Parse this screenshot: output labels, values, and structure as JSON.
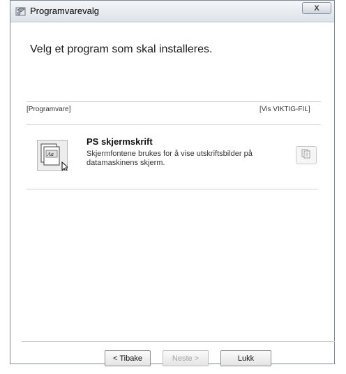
{
  "window": {
    "title": "Programvarevalg",
    "close_label": "X"
  },
  "main": {
    "heading": "Velg et program som skal installeres."
  },
  "software_list": {
    "header_left": "[Programvare]",
    "header_right": "[Vis VIKTIG-FIL]",
    "items": [
      {
        "title": "PS skjermskrift",
        "description": "Skjermfontene brukes for å vise utskriftsbilder på datamaskinens skjerm.",
        "icon": "font-document-icon",
        "action_icon": "readme-document-icon"
      }
    ]
  },
  "footer": {
    "back_label": "< Tibake",
    "next_label": "Neste >",
    "close_label": "Lukk"
  }
}
